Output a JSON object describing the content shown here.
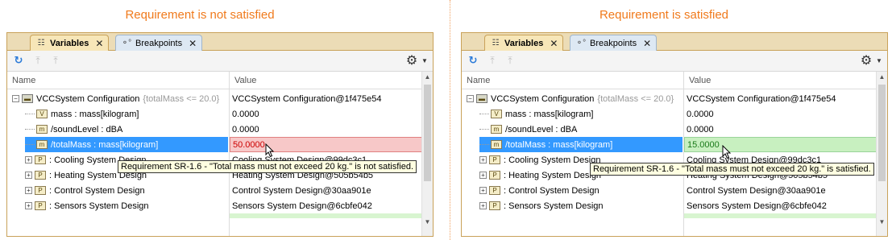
{
  "left": {
    "caption": "Requirement is not satisfied",
    "tabs": {
      "variables": "Variables",
      "breakpoints": "Breakpoints"
    },
    "columns": {
      "name": "Name",
      "value": "Value"
    },
    "rows": [
      {
        "name": "VCCSystem Configuration",
        "constraint": "{totalMass <= 20.0}",
        "value": "VCCSystem Configuration@1f475e54"
      },
      {
        "name": "mass : mass[kilogram]",
        "icon": "V",
        "value": "0.0000"
      },
      {
        "name": "/soundLevel : dBA",
        "icon": "m",
        "value": "0.0000"
      },
      {
        "name": "/totalMass : mass[kilogram]",
        "icon": "m",
        "value": "50.0000"
      },
      {
        "name": ": Cooling System Design",
        "icon": "P",
        "value": "Cooling System Design@99dc3c1"
      },
      {
        "name": ": Heating System Design",
        "icon": "P",
        "value": "Heating System Design@505b54b5"
      },
      {
        "name": ": Control System Design",
        "icon": "P",
        "value": "Control System Design@30aa901e"
      },
      {
        "name": ": Sensors System Design",
        "icon": "P",
        "value": "Sensors System Design@6cbfe042"
      }
    ],
    "tooltip": "Requirement SR-1.6 - \"Total mass must not exceed 20 kg.\" is not satisfied.",
    "status_color": "#cc0000"
  },
  "right": {
    "caption": "Requirement is satisfied",
    "tabs": {
      "variables": "Variables",
      "breakpoints": "Breakpoints"
    },
    "columns": {
      "name": "Name",
      "value": "Value"
    },
    "rows": [
      {
        "name": "VCCSystem Configuration",
        "constraint": "{totalMass <= 20.0}",
        "value": "VCCSystem Configuration@1f475e54"
      },
      {
        "name": "mass : mass[kilogram]",
        "icon": "V",
        "value": "0.0000"
      },
      {
        "name": "/soundLevel : dBA",
        "icon": "m",
        "value": "0.0000"
      },
      {
        "name": "/totalMass : mass[kilogram]",
        "icon": "m",
        "value": "15.0000"
      },
      {
        "name": ": Cooling System Design",
        "icon": "P",
        "value": "Cooling System Design@99dc3c1"
      },
      {
        "name": ": Heating System Design",
        "icon": "P",
        "value": "Heating System Design@505b54b5"
      },
      {
        "name": ": Control System Design",
        "icon": "P",
        "value": "Control System Design@30aa901e"
      },
      {
        "name": ": Sensors System Design",
        "icon": "P",
        "value": "Sensors System Design@6cbfe042"
      }
    ],
    "tooltip": "Requirement SR-1.6 - \"Total mass must not exceed 20 kg.\" is satisfied.",
    "status_color": "#1a7a1a"
  },
  "icons": {
    "variables_tab": "tree-icon",
    "breakpoints_tab": "breakpoints-icon",
    "toolbar": [
      "refresh-icon",
      "step-into-icon",
      "step-over-icon",
      "gear-icon",
      "dropdown-caret-icon"
    ]
  },
  "colors": {
    "accent_caption": "#f07a1c",
    "selection": "#3399ff",
    "not_satisfied_bg": "#f7c8c8",
    "satisfied_bg": "#c8f0c0"
  }
}
